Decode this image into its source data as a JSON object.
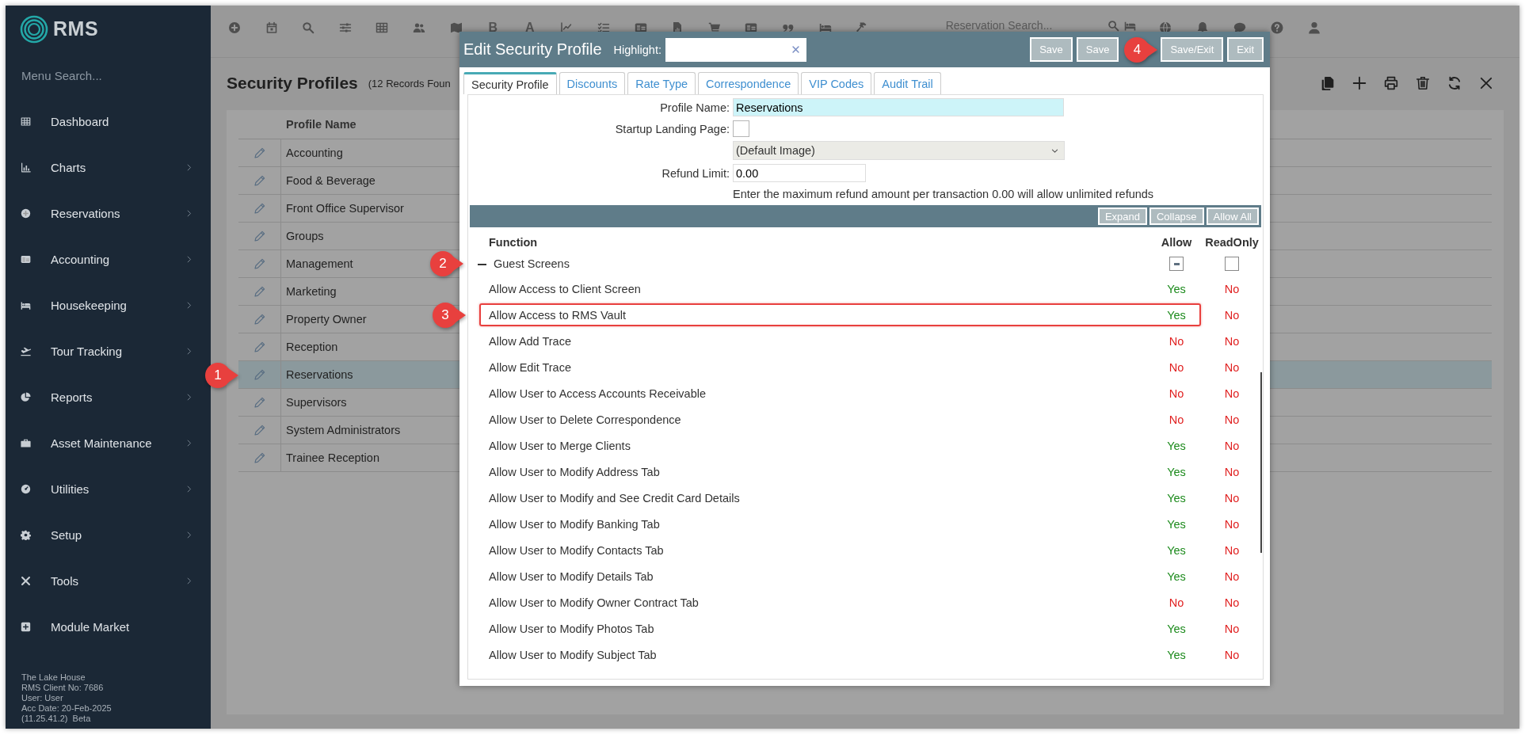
{
  "sidebar": {
    "logo": "RMS",
    "menu_search": {
      "placeholder": "Menu Search..."
    },
    "items": [
      {
        "label": "Dashboard",
        "has_submenu": false
      },
      {
        "label": "Charts",
        "has_submenu": true
      },
      {
        "label": "Reservations",
        "has_submenu": true
      },
      {
        "label": "Accounting",
        "has_submenu": true
      },
      {
        "label": "Housekeeping",
        "has_submenu": true
      },
      {
        "label": "Tour Tracking",
        "has_submenu": true
      },
      {
        "label": "Reports",
        "has_submenu": true
      },
      {
        "label": "Asset Maintenance",
        "has_submenu": true
      },
      {
        "label": "Utilities",
        "has_submenu": true
      },
      {
        "label": "Setup",
        "has_submenu": true
      },
      {
        "label": "Tools",
        "has_submenu": true
      },
      {
        "label": "Module Market",
        "has_submenu": false
      }
    ],
    "footer": [
      "The Lake House",
      "RMS Client No: 7686",
      "User: User",
      "Acc Date: 20-Feb-2025",
      "(11.25.41.2)  Beta"
    ]
  },
  "toolbar": {
    "letters": [
      "B",
      "A"
    ],
    "search": {
      "placeholder": "Reservation Search..."
    }
  },
  "page": {
    "title": "Security Profiles",
    "count": "(12 Records Foun",
    "table": {
      "columns": [
        "Profile Name"
      ],
      "rows": [
        {
          "name": "Accounting",
          "selected": false
        },
        {
          "name": "Food & Beverage",
          "selected": false
        },
        {
          "name": "Front Office Supervisor",
          "selected": false
        },
        {
          "name": "Groups",
          "selected": false
        },
        {
          "name": "Management",
          "selected": false
        },
        {
          "name": "Marketing",
          "selected": false
        },
        {
          "name": "Property Owner",
          "selected": false
        },
        {
          "name": "Reception",
          "selected": false
        },
        {
          "name": "Reservations",
          "selected": true,
          "callout": "1"
        },
        {
          "name": "Supervisors",
          "selected": false
        },
        {
          "name": "System Administrators",
          "selected": false
        },
        {
          "name": "Trainee Reception",
          "selected": false
        }
      ]
    }
  },
  "dialog": {
    "title": "Edit Security Profile",
    "highlight_label": "Highlight:",
    "buttons": [
      {
        "label": "Save"
      },
      {
        "label": "Save"
      },
      {
        "label": "Save/Exit",
        "callout": "4"
      },
      {
        "label": "Exit"
      }
    ],
    "tabs": [
      {
        "label": "Security Profile",
        "selected": true
      },
      {
        "label": "Discounts",
        "selected": false
      },
      {
        "label": "Rate Type",
        "selected": false
      },
      {
        "label": "Correspondence",
        "selected": false
      },
      {
        "label": "VIP Codes",
        "selected": false
      },
      {
        "label": "Audit Trail",
        "selected": false
      }
    ],
    "form": {
      "profile_name": {
        "label": "Profile Name:",
        "value": "Reservations"
      },
      "startup_landing_page": {
        "label": "Startup Landing Page:",
        "checked": false
      },
      "image_select": {
        "value": "(Default Image)"
      },
      "refund_limit": {
        "label": "Refund Limit:",
        "value": "0.00"
      },
      "refund_hint": "Enter the maximum refund amount per transaction 0.00 will allow unlimited refunds"
    },
    "permission_buttons": [
      "Expand",
      "Collapse",
      "Allow All"
    ],
    "permissions": {
      "columns": [
        "Function",
        "Allow",
        "ReadOnly"
      ],
      "groups": [
        {
          "label": "Guest Screens",
          "expanded": true,
          "callout": "2",
          "allow_partial": true,
          "read_only_checked": false,
          "rows": [
            {
              "function": "Allow Access to Client Screen",
              "highlighted": false,
              "allow": {
                "text": "Yes",
                "granted": true
              },
              "read_only": {
                "text": "No",
                "granted": false
              }
            },
            {
              "function": "Allow Access to RMS Vault",
              "highlighted": true,
              "callout": "3",
              "allow": {
                "text": "Yes",
                "granted": true
              },
              "read_only": {
                "text": "No",
                "granted": false
              }
            },
            {
              "function": "Allow Add Trace",
              "highlighted": false,
              "allow": {
                "text": "No",
                "granted": false
              },
              "read_only": {
                "text": "No",
                "granted": false
              }
            },
            {
              "function": "Allow Edit Trace",
              "highlighted": false,
              "allow": {
                "text": "No",
                "granted": false
              },
              "read_only": {
                "text": "No",
                "granted": false
              }
            },
            {
              "function": "Allow User to Access Accounts Receivable",
              "highlighted": false,
              "allow": {
                "text": "No",
                "granted": false
              },
              "read_only": {
                "text": "No",
                "granted": false
              }
            },
            {
              "function": "Allow User to Delete Correspondence",
              "highlighted": false,
              "allow": {
                "text": "No",
                "granted": false
              },
              "read_only": {
                "text": "No",
                "granted": false
              }
            },
            {
              "function": "Allow User to Merge Clients",
              "highlighted": false,
              "allow": {
                "text": "Yes",
                "granted": true
              },
              "read_only": {
                "text": "No",
                "granted": false
              }
            },
            {
              "function": "Allow User to Modify Address Tab",
              "highlighted": false,
              "allow": {
                "text": "Yes",
                "granted": true
              },
              "read_only": {
                "text": "No",
                "granted": false
              }
            },
            {
              "function": "Allow User to Modify and See Credit Card Details",
              "highlighted": false,
              "allow": {
                "text": "Yes",
                "granted": true
              },
              "read_only": {
                "text": "No",
                "granted": false
              }
            },
            {
              "function": "Allow User to Modify Banking Tab",
              "highlighted": false,
              "allow": {
                "text": "Yes",
                "granted": true
              },
              "read_only": {
                "text": "No",
                "granted": false
              }
            },
            {
              "function": "Allow User to Modify Contacts Tab",
              "highlighted": false,
              "allow": {
                "text": "Yes",
                "granted": true
              },
              "read_only": {
                "text": "No",
                "granted": false
              }
            },
            {
              "function": "Allow User to Modify Details Tab",
              "highlighted": false,
              "allow": {
                "text": "Yes",
                "granted": true
              },
              "read_only": {
                "text": "No",
                "granted": false
              }
            },
            {
              "function": "Allow User to Modify Owner Contract Tab",
              "highlighted": false,
              "allow": {
                "text": "No",
                "granted": false
              },
              "read_only": {
                "text": "No",
                "granted": false
              }
            },
            {
              "function": "Allow User to Modify Photos Tab",
              "highlighted": false,
              "allow": {
                "text": "Yes",
                "granted": true
              },
              "read_only": {
                "text": "No",
                "granted": false
              }
            },
            {
              "function": "Allow User to Modify Subject Tab",
              "highlighted": false,
              "allow": {
                "text": "Yes",
                "granted": true
              },
              "read_only": {
                "text": "No",
                "granted": false
              }
            }
          ]
        }
      ]
    }
  }
}
